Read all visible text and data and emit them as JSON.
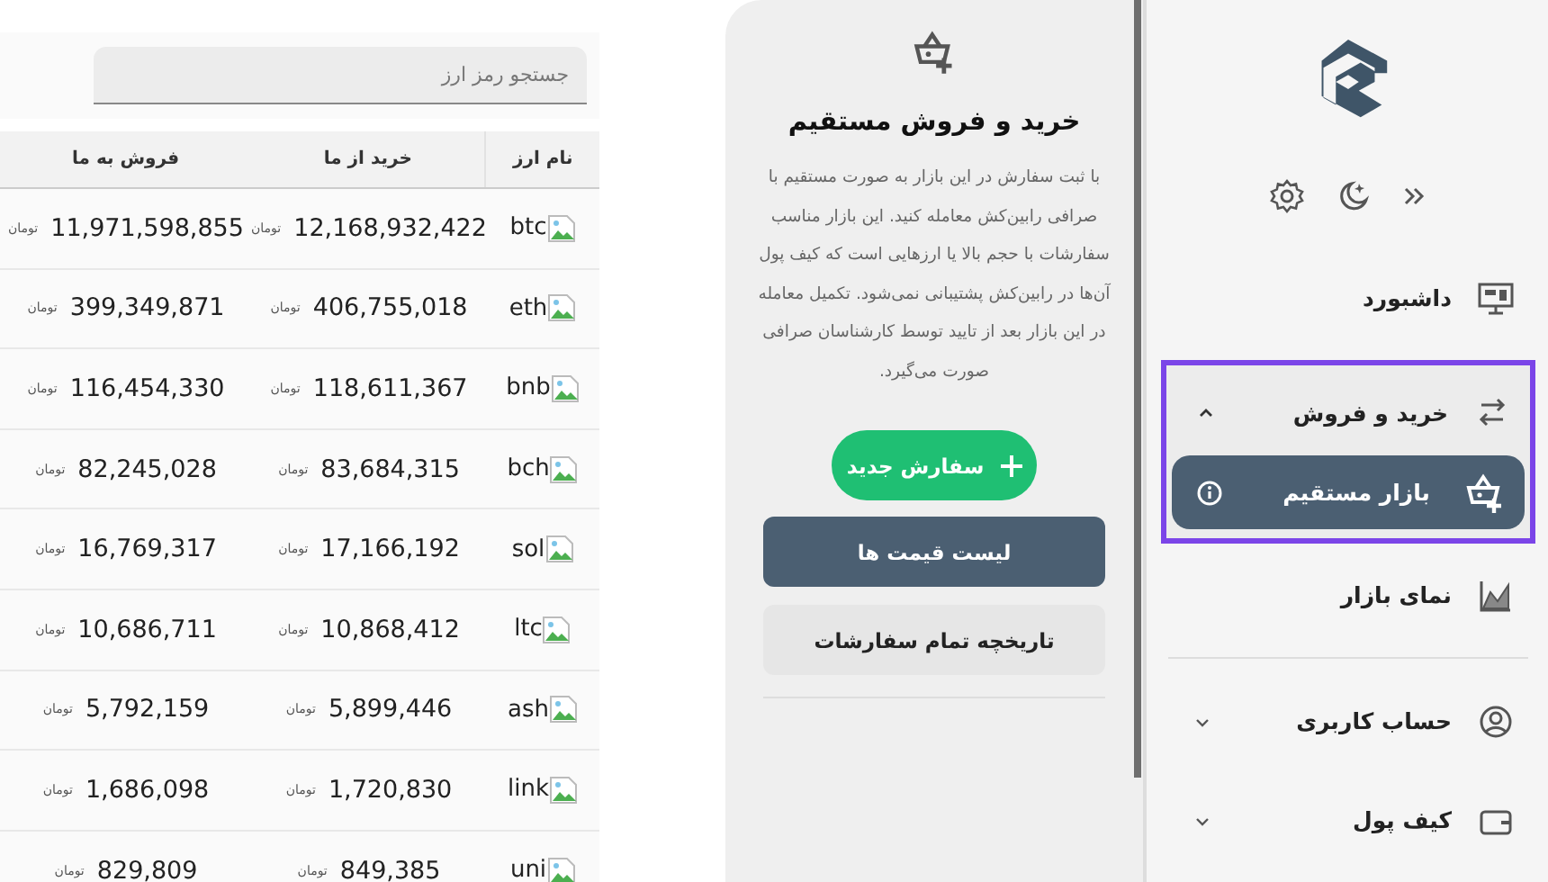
{
  "sidebar": {
    "items": [
      {
        "label": "داشبورد",
        "selected": false
      },
      {
        "label": "خرید و فروش",
        "selected": false,
        "expanded": true,
        "highlighted": true,
        "children": [
          {
            "label": "بازار مستقیم",
            "selected": true
          }
        ]
      },
      {
        "label": "نمای بازار",
        "selected": false
      },
      {
        "label": "حساب کاربری",
        "selected": false,
        "expanded": false
      },
      {
        "label": "کیف پول",
        "selected": false,
        "expanded": false
      }
    ]
  },
  "panel": {
    "title": "خرید و فروش مستقیم",
    "description": "با ثبت سفارش در این بازار به صورت مستقیم با صرافی رابین‌کش معامله کنید. این بازار مناسب سفارشات با حجم بالا یا ارزهایی است که کیف پول آن‌ها در رابین‌کش پشتیبانی نمی‌شود. تکمیل معامله در این بازار بعد از تایید توسط کارشناسان صرافی صورت می‌گیرد.",
    "buttons": [
      {
        "kind": "primary",
        "label": "سفارش جدید"
      },
      {
        "kind": "active",
        "label": "لیست قیمت ها"
      },
      {
        "kind": "plain",
        "label": "تاریخچه تمام سفارشات"
      }
    ]
  },
  "search": {
    "placeholder": "جستجو رمز ارز"
  },
  "table": {
    "columns": [
      "نام ارز",
      "خرید از ما",
      "فروش به ما"
    ],
    "rows": [
      {
        "name": "btc",
        "buy": "12,168,932,422",
        "buy_unit": "تومان",
        "sell": "11,971,598,855",
        "sell_unit": "تومان"
      },
      {
        "name": "eth",
        "buy": "406,755,018",
        "buy_unit": "تومان",
        "sell": "399,349,871",
        "sell_unit": "تومان"
      },
      {
        "name": "bnb",
        "buy": "118,611,367",
        "buy_unit": "تومان",
        "sell": "116,454,330",
        "sell_unit": "تومان"
      },
      {
        "name": "bch",
        "buy": "83,684,315",
        "buy_unit": "تومان",
        "sell": "82,245,028",
        "sell_unit": "تومان"
      },
      {
        "name": "sol",
        "buy": "17,166,192",
        "buy_unit": "تومان",
        "sell": "16,769,317",
        "sell_unit": "تومان"
      },
      {
        "name": "ltc",
        "buy": "10,868,412",
        "buy_unit": "تومان",
        "sell": "10,686,711",
        "sell_unit": "تومان"
      },
      {
        "name": "ash",
        "buy": "5,899,446",
        "buy_unit": "تومان",
        "sell": "5,792,159",
        "sell_unit": "تومان"
      },
      {
        "name": "link",
        "buy": "1,720,830",
        "buy_unit": "تومان",
        "sell": "1,686,098",
        "sell_unit": "تومان"
      },
      {
        "name": "uni",
        "buy": "849,385",
        "buy_unit": "تومان",
        "sell": "829,809",
        "sell_unit": "تومان"
      }
    ]
  }
}
